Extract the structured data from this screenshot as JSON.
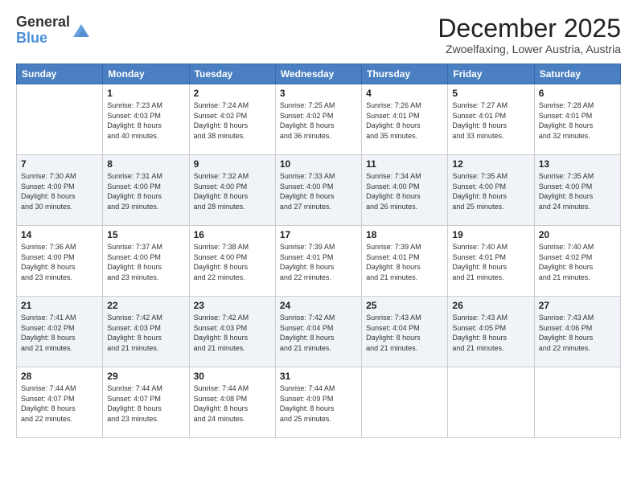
{
  "logo": {
    "general": "General",
    "blue": "Blue"
  },
  "title": {
    "month": "December 2025",
    "location": "Zwoelfaxing, Lower Austria, Austria"
  },
  "header_days": [
    "Sunday",
    "Monday",
    "Tuesday",
    "Wednesday",
    "Thursday",
    "Friday",
    "Saturday"
  ],
  "weeks": [
    [
      {
        "day": "",
        "info": ""
      },
      {
        "day": "1",
        "info": "Sunrise: 7:23 AM\nSunset: 4:03 PM\nDaylight: 8 hours\nand 40 minutes."
      },
      {
        "day": "2",
        "info": "Sunrise: 7:24 AM\nSunset: 4:02 PM\nDaylight: 8 hours\nand 38 minutes."
      },
      {
        "day": "3",
        "info": "Sunrise: 7:25 AM\nSunset: 4:02 PM\nDaylight: 8 hours\nand 36 minutes."
      },
      {
        "day": "4",
        "info": "Sunrise: 7:26 AM\nSunset: 4:01 PM\nDaylight: 8 hours\nand 35 minutes."
      },
      {
        "day": "5",
        "info": "Sunrise: 7:27 AM\nSunset: 4:01 PM\nDaylight: 8 hours\nand 33 minutes."
      },
      {
        "day": "6",
        "info": "Sunrise: 7:28 AM\nSunset: 4:01 PM\nDaylight: 8 hours\nand 32 minutes."
      }
    ],
    [
      {
        "day": "7",
        "info": "Sunrise: 7:30 AM\nSunset: 4:00 PM\nDaylight: 8 hours\nand 30 minutes."
      },
      {
        "day": "8",
        "info": "Sunrise: 7:31 AM\nSunset: 4:00 PM\nDaylight: 8 hours\nand 29 minutes."
      },
      {
        "day": "9",
        "info": "Sunrise: 7:32 AM\nSunset: 4:00 PM\nDaylight: 8 hours\nand 28 minutes."
      },
      {
        "day": "10",
        "info": "Sunrise: 7:33 AM\nSunset: 4:00 PM\nDaylight: 8 hours\nand 27 minutes."
      },
      {
        "day": "11",
        "info": "Sunrise: 7:34 AM\nSunset: 4:00 PM\nDaylight: 8 hours\nand 26 minutes."
      },
      {
        "day": "12",
        "info": "Sunrise: 7:35 AM\nSunset: 4:00 PM\nDaylight: 8 hours\nand 25 minutes."
      },
      {
        "day": "13",
        "info": "Sunrise: 7:35 AM\nSunset: 4:00 PM\nDaylight: 8 hours\nand 24 minutes."
      }
    ],
    [
      {
        "day": "14",
        "info": "Sunrise: 7:36 AM\nSunset: 4:00 PM\nDaylight: 8 hours\nand 23 minutes."
      },
      {
        "day": "15",
        "info": "Sunrise: 7:37 AM\nSunset: 4:00 PM\nDaylight: 8 hours\nand 23 minutes."
      },
      {
        "day": "16",
        "info": "Sunrise: 7:38 AM\nSunset: 4:00 PM\nDaylight: 8 hours\nand 22 minutes."
      },
      {
        "day": "17",
        "info": "Sunrise: 7:39 AM\nSunset: 4:01 PM\nDaylight: 8 hours\nand 22 minutes."
      },
      {
        "day": "18",
        "info": "Sunrise: 7:39 AM\nSunset: 4:01 PM\nDaylight: 8 hours\nand 21 minutes."
      },
      {
        "day": "19",
        "info": "Sunrise: 7:40 AM\nSunset: 4:01 PM\nDaylight: 8 hours\nand 21 minutes."
      },
      {
        "day": "20",
        "info": "Sunrise: 7:40 AM\nSunset: 4:02 PM\nDaylight: 8 hours\nand 21 minutes."
      }
    ],
    [
      {
        "day": "21",
        "info": "Sunrise: 7:41 AM\nSunset: 4:02 PM\nDaylight: 8 hours\nand 21 minutes."
      },
      {
        "day": "22",
        "info": "Sunrise: 7:42 AM\nSunset: 4:03 PM\nDaylight: 8 hours\nand 21 minutes."
      },
      {
        "day": "23",
        "info": "Sunrise: 7:42 AM\nSunset: 4:03 PM\nDaylight: 8 hours\nand 21 minutes."
      },
      {
        "day": "24",
        "info": "Sunrise: 7:42 AM\nSunset: 4:04 PM\nDaylight: 8 hours\nand 21 minutes."
      },
      {
        "day": "25",
        "info": "Sunrise: 7:43 AM\nSunset: 4:04 PM\nDaylight: 8 hours\nand 21 minutes."
      },
      {
        "day": "26",
        "info": "Sunrise: 7:43 AM\nSunset: 4:05 PM\nDaylight: 8 hours\nand 21 minutes."
      },
      {
        "day": "27",
        "info": "Sunrise: 7:43 AM\nSunset: 4:06 PM\nDaylight: 8 hours\nand 22 minutes."
      }
    ],
    [
      {
        "day": "28",
        "info": "Sunrise: 7:44 AM\nSunset: 4:07 PM\nDaylight: 8 hours\nand 22 minutes."
      },
      {
        "day": "29",
        "info": "Sunrise: 7:44 AM\nSunset: 4:07 PM\nDaylight: 8 hours\nand 23 minutes."
      },
      {
        "day": "30",
        "info": "Sunrise: 7:44 AM\nSunset: 4:08 PM\nDaylight: 8 hours\nand 24 minutes."
      },
      {
        "day": "31",
        "info": "Sunrise: 7:44 AM\nSunset: 4:09 PM\nDaylight: 8 hours\nand 25 minutes."
      },
      {
        "day": "",
        "info": ""
      },
      {
        "day": "",
        "info": ""
      },
      {
        "day": "",
        "info": ""
      }
    ]
  ]
}
